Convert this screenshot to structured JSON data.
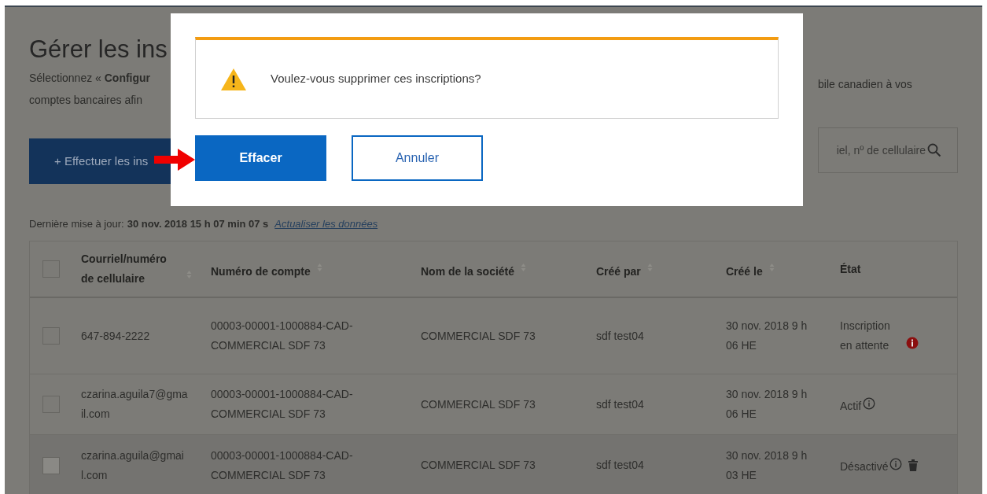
{
  "page": {
    "title_fragment": "Gérer les ins",
    "description_fragments_left": [
      {
        "text": "Sélectionnez « **Configur**"
      },
      {
        "text": "comptes bancaires afin"
      }
    ],
    "description_fragment_right": "bile canadien à vos",
    "add_button_fragment": "+ Effectuer les ins",
    "search_fragment": "iel, nº de cellulaire",
    "last_update_label": "Dernière mise à jour:",
    "last_update_value": "30 nov. 2018 15 h 07 min 07 s",
    "refresh_link": "Actualiser les données"
  },
  "table": {
    "select_all_checked": false,
    "columns": [
      {
        "label": "Courriel/numéro de cellulaire",
        "sortable": true
      },
      {
        "label": "Numéro de compte",
        "sortable": true
      },
      {
        "label": "Nom de la société",
        "sortable": true
      },
      {
        "label": "Créé par",
        "sortable": true
      },
      {
        "label": "Créé le",
        "sortable": true
      },
      {
        "label": "État",
        "sortable": false
      }
    ],
    "rows": [
      {
        "checked": false,
        "disabled": false,
        "contact": "647-894-2222",
        "account": "00003-00001-1000884-CAD-COMMERCIAL SDF 73",
        "company": "COMMERCIAL SDF 73",
        "created_by": "sdf test04",
        "created_on": "30 nov. 2018 9 h 06 HE",
        "status": "Inscription en attente",
        "status_alert": true,
        "deletable": false
      },
      {
        "checked": false,
        "disabled": false,
        "contact": "czarina.aguila7@gmail.com",
        "account": "00003-00001-1000884-CAD-COMMERCIAL SDF 73",
        "company": "COMMERCIAL SDF 73",
        "created_by": "sdf test04",
        "created_on": "30 nov. 2018 9 h 06 HE",
        "status": "Actif",
        "status_alert": false,
        "deletable": false
      },
      {
        "checked": false,
        "disabled": true,
        "contact": "czarina.aguila@gmail.com",
        "account": "00003-00001-1000884-CAD-COMMERCIAL SDF 73",
        "company": "COMMERCIAL SDF 73",
        "created_by": "sdf test04",
        "created_on": "30 nov. 2018 9 h 03 HE",
        "status": "Désactivé",
        "status_alert": false,
        "deletable": true
      }
    ]
  },
  "dialog": {
    "message": "Voulez-vous supprimer ces inscriptions?",
    "buttons": [
      {
        "label": "Effacer",
        "kind": "primary"
      },
      {
        "label": "Annuler",
        "kind": "secondary"
      }
    ],
    "pointer_arrow": true
  }
}
